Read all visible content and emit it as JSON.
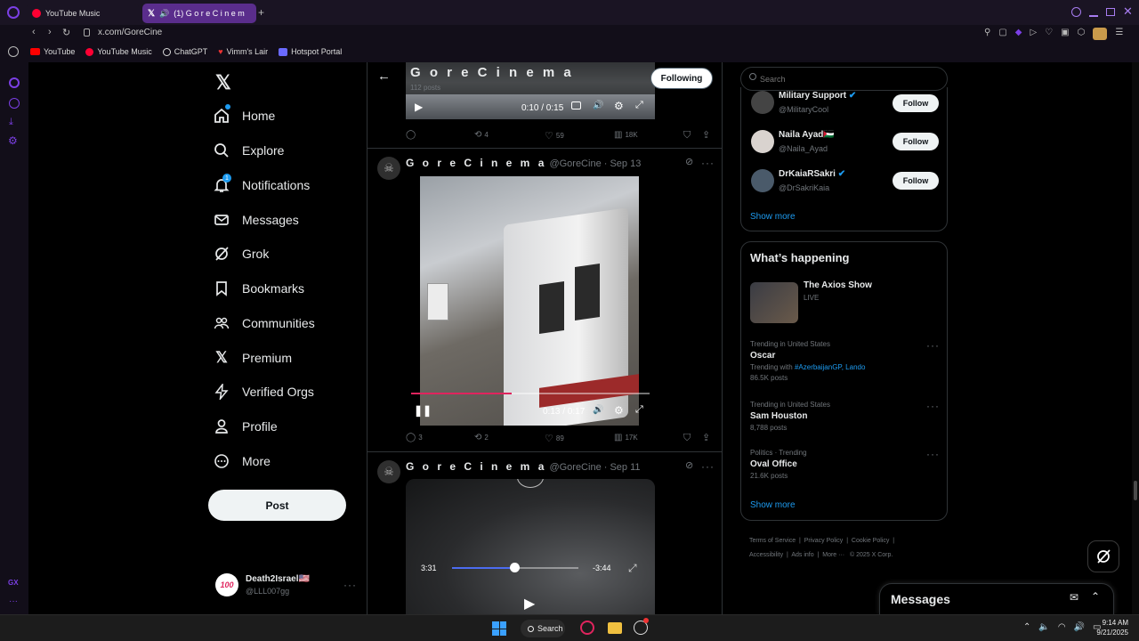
{
  "browser": {
    "tabs": [
      {
        "label": "YouTube Music",
        "active": false
      },
      {
        "label": "(1) G o r e  C i n e m",
        "active": true
      }
    ],
    "new_tab": "+",
    "url": "x.com/GoreCine",
    "bookmarks": [
      "YouTube",
      "YouTube Music",
      "ChatGPT",
      "Vimm's Lair",
      "Hotspot Portal"
    ],
    "gx_label": "GX"
  },
  "nav": {
    "items": [
      "Home",
      "Explore",
      "Notifications",
      "Messages",
      "Grok",
      "Bookmarks",
      "Communities",
      "Premium",
      "Verified Orgs",
      "Profile",
      "More"
    ],
    "notifications_badge": "1",
    "post_button": "Post",
    "account": {
      "name": "Death2Israel🇺🇸",
      "handle": "@LLL007gg"
    }
  },
  "profile_header": {
    "name": "G o r e  C i n e m a",
    "posts": "112 posts",
    "following_button": "Following"
  },
  "posts": [
    {
      "video_time": "0:10 / 0:15",
      "replies": "",
      "reposts": "4",
      "likes": "59",
      "views": "18K"
    },
    {
      "name": "G o r e  C i n e m a",
      "handle": "@GoreCine",
      "date": "· Sep 13",
      "video_time": "0:13 / 0:17",
      "progress": 0.42,
      "replies": "3",
      "reposts": "2",
      "likes": "89",
      "views": "17K"
    },
    {
      "name": "G o r e  C i n e m a",
      "handle": "@GoreCine",
      "date": "· Sep 11",
      "time_elapsed": "3:31",
      "time_remaining": "-3:44",
      "progress": 0.49
    }
  ],
  "right": {
    "search_placeholder": "Search",
    "who_to_follow": [
      {
        "name": "Military Support",
        "handle": "@MilitaryCool",
        "verified": true,
        "button": "Follow"
      },
      {
        "name": "Naila Ayad🇵🇸",
        "handle": "@Naila_Ayad",
        "verified": false,
        "button": "Follow"
      },
      {
        "name": "DrKaiaRSakri",
        "handle": "@DrSakriKaia",
        "verified": true,
        "button": "Follow"
      }
    ],
    "show_more_1": "Show more",
    "happening_title": "What’s happening",
    "live_event": {
      "title": "The Axios Show",
      "status": "LIVE"
    },
    "trends": [
      {
        "context": "Trending in United States",
        "title": "Oscar",
        "extra_prefix": "Trending with ",
        "extra_links": "#AzerbaijanGP, Lando",
        "posts": "86.5K posts"
      },
      {
        "context": "Trending in United States",
        "title": "Sam Houston",
        "posts": "8,788 posts"
      },
      {
        "context": "Politics · Trending",
        "title": "Oval Office",
        "posts": "21.6K posts"
      }
    ],
    "show_more_2": "Show more",
    "footer": [
      "Terms of Service",
      "Privacy Policy",
      "Cookie Policy",
      "Accessibility",
      "Ads info",
      "More ···",
      "© 2025 X Corp."
    ],
    "messages_label": "Messages"
  },
  "taskbar": {
    "search_label": "Search",
    "time": "9:14 AM",
    "date": "9/21/2025"
  },
  "colors": {
    "accent_blue": "#1d9bf0",
    "opera_purple": "#7b3fe4",
    "tab_active": "#5a2d8c",
    "red_progress": "#e0245e"
  }
}
